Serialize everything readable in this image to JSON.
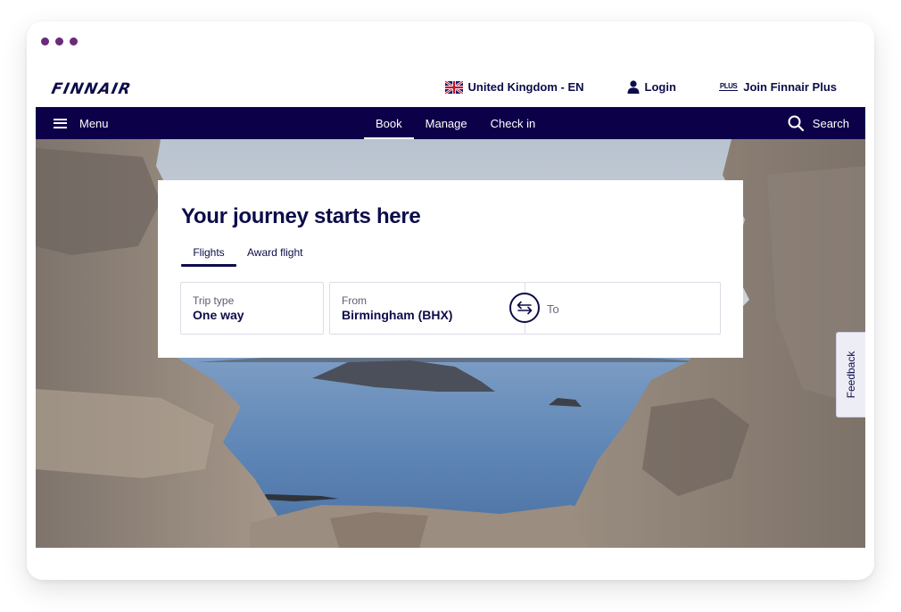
{
  "window": {
    "dots": [
      "dot-1",
      "dot-2",
      "dot-3"
    ],
    "accent_dot_color": "#6b2a7a"
  },
  "header": {
    "logo": "FINNAIR",
    "locale_label": "United Kingdom - EN",
    "locale_icon": "uk-flag-icon",
    "login_label": "Login",
    "login_icon": "user-icon",
    "join_label": "Join Finnair Plus",
    "join_icon": "finnair-plus-icon",
    "join_icon_text": "PLUS"
  },
  "nav": {
    "menu_label": "Menu",
    "tabs": [
      {
        "label": "Book",
        "active": true
      },
      {
        "label": "Manage",
        "active": false
      },
      {
        "label": "Check in",
        "active": false
      }
    ],
    "search_label": "Search",
    "background_color": "#0c0049"
  },
  "booking": {
    "title": "Your journey starts here",
    "tabs": [
      {
        "label": "Flights",
        "active": true
      },
      {
        "label": "Award flight",
        "active": false
      }
    ],
    "trip_type": {
      "label": "Trip type",
      "value": "One way"
    },
    "from": {
      "label": "From",
      "value": "Birmingham (BHX)"
    },
    "to": {
      "label": "To",
      "value": ""
    },
    "swap_icon": "swap-arrows-icon"
  },
  "feedback": {
    "label": "Feedback"
  },
  "colors": {
    "brand_navy": "#0c0c4a",
    "field_border": "#dcdce6"
  }
}
